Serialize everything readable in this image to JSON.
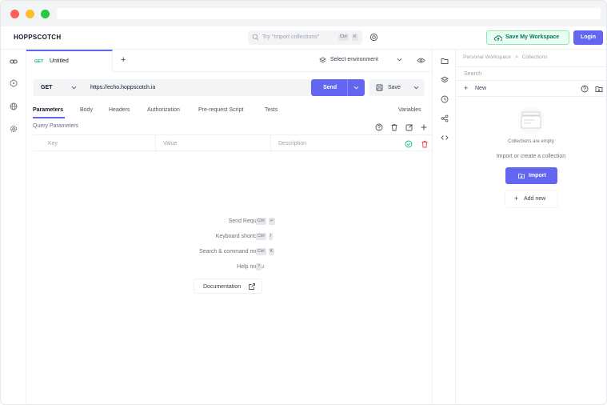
{
  "window": {
    "dot_colors": [
      "#fe5f57",
      "#febc2e",
      "#28c840"
    ]
  },
  "header": {
    "brand": "HOPPSCOTCH",
    "search_placeholder": "Try \"Import collections\"",
    "search_keys": [
      "Ctrl",
      "K"
    ],
    "save_workspace_label": "Save My Workspace",
    "login_label": "Login",
    "accent_color": "#6366f1"
  },
  "rail": {
    "icons": [
      "link-icon",
      "graphql-icon",
      "globe-icon",
      "settings-icon"
    ]
  },
  "tab": {
    "method": "GET",
    "title": "Untitled",
    "add_label": "+"
  },
  "environment": {
    "label": "Select environment"
  },
  "request": {
    "method": "GET",
    "url": "https://echo.hoppscotch.io",
    "send_label": "Send",
    "save_label": "Save"
  },
  "subtabs": {
    "items": [
      "Parameters",
      "Body",
      "Headers",
      "Authorization",
      "Pre-request Script",
      "Tests"
    ],
    "active": "Parameters",
    "variables_label": "Variables"
  },
  "params": {
    "section_label": "Query Parameters",
    "key_placeholder": "Key",
    "value_placeholder": "Value",
    "description_placeholder": "Description"
  },
  "shortcuts": [
    {
      "label": "Send Request",
      "keys": [
        "Ctrl",
        "↵"
      ]
    },
    {
      "label": "Keyboard shortcuts",
      "keys": [
        "Ctrl",
        "/"
      ]
    },
    {
      "label": "Search & command menu",
      "keys": [
        "Ctrl",
        "K"
      ]
    },
    {
      "label": "Help menu",
      "keys": [
        "?"
      ]
    }
  ],
  "documentation_label": "Documentation",
  "collections": {
    "breadcrumb": [
      "Personal Workspace",
      "Collections"
    ],
    "breadcrumb_sep": ">",
    "search_placeholder": "Search",
    "new_label": "New",
    "empty_title": "Collections are empty",
    "empty_subtitle": "Import or create a collection",
    "import_label": "Import",
    "add_new_label": "Add new"
  }
}
